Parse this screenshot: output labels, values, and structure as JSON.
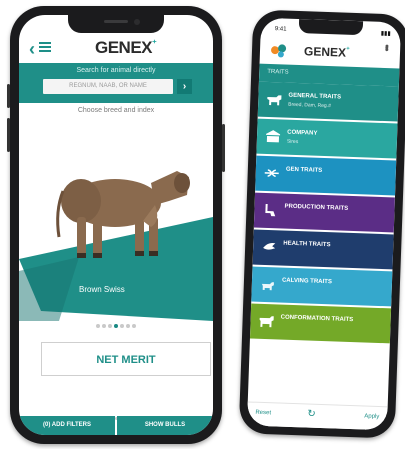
{
  "phone1": {
    "brand": "GENEX",
    "search_label": "Search for animal directly",
    "search_placeholder": "REGNUM, NAAB, OR NAME",
    "hint": "Choose breed and index",
    "breed_name": "Brown Swiss",
    "carousel_active_index": 3,
    "carousel_total": 7,
    "index_button": "NET MERIT",
    "page_dots_active_index": 0,
    "page_dots_total": 3,
    "footer": {
      "filters_label": "(0) ADD FILTERS",
      "show_label": "SHOW BULLS"
    }
  },
  "phone2": {
    "time": "9:41",
    "brand": "GENEX",
    "tab_label": "TRAITS",
    "traits": [
      {
        "name": "GENERAL TRAITS",
        "sub": "Breed, Dam, Reg.#",
        "color": "#1f8f88",
        "icon": "cow-icon"
      },
      {
        "name": "COMPANY",
        "sub": "Sires",
        "color": "#2aa7a0",
        "icon": "building-icon"
      },
      {
        "name": "GEN TRAITS",
        "sub": "",
        "color": "#1d92c1",
        "icon": "dna-icon"
      },
      {
        "name": "PRODUCTION TRAITS",
        "sub": "",
        "color": "#5b2d86",
        "icon": "milking-icon"
      },
      {
        "name": "HEALTH TRAITS",
        "sub": "",
        "color": "#1f3d6d",
        "icon": "shield-icon"
      },
      {
        "name": "CALVING TRAITS",
        "sub": "",
        "color": "#35a8cc",
        "icon": "calf-icon"
      },
      {
        "name": "CONFORMATION TRAITS",
        "sub": "",
        "color": "#74a928",
        "icon": "cow-side-icon"
      }
    ],
    "footer": {
      "reset_label": "Reset",
      "apply_label": "Apply"
    }
  },
  "colors": {
    "teal": "#1f8f88",
    "teal_dark": "#127a74",
    "text_dark": "#2b2b2b"
  }
}
